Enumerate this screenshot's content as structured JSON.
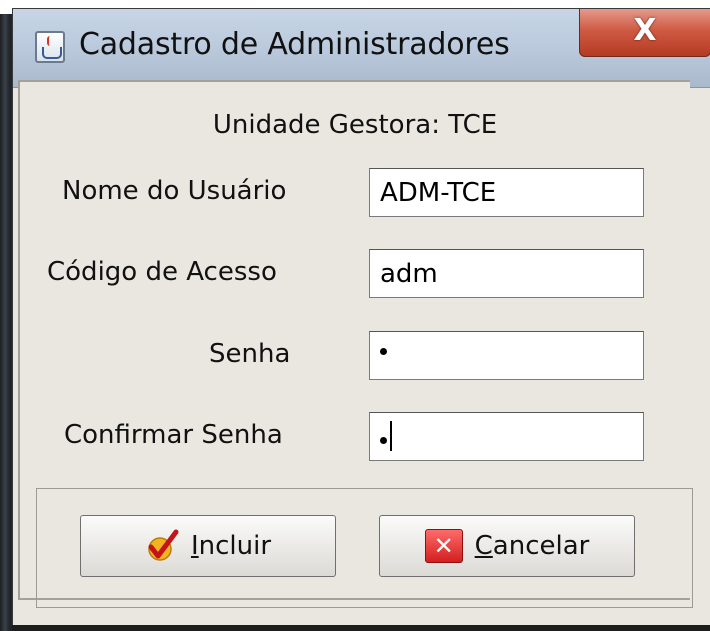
{
  "window": {
    "title": "Cadastro de Administradores",
    "close_glyph": "X"
  },
  "form": {
    "unit_label": "Unidade Gestora: TCE",
    "fields": [
      {
        "label": "Nome do Usuário",
        "value": "ADM-TCE"
      },
      {
        "label": "Código de Acesso",
        "value": "adm"
      },
      {
        "label": "Senha",
        "value": "•"
      },
      {
        "label": "Confirmar Senha",
        "value": "•"
      }
    ]
  },
  "buttons": {
    "include": {
      "label_mnemonic": "I",
      "label_rest": "ncluir",
      "icon": "checkmark-icon"
    },
    "cancel": {
      "label_mnemonic": "C",
      "label_rest": "ancelar",
      "icon": "x-icon"
    }
  },
  "colors": {
    "titlebar": "#bccbdd",
    "close": "#cf5a43",
    "panel": "#eae7e1"
  }
}
